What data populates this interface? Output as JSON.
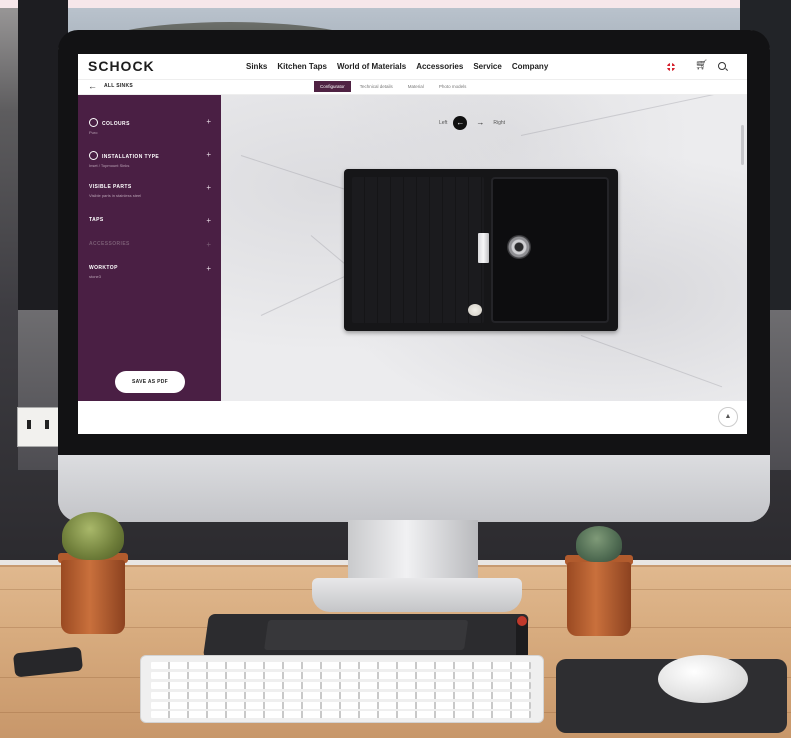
{
  "header": {
    "logo": "SCHOCK",
    "nav": [
      "Sinks",
      "Kitchen Taps",
      "World of Materials",
      "Accessories",
      "Service",
      "Company"
    ],
    "icons": [
      "flag-icon",
      "cart-icon",
      "search-icon"
    ]
  },
  "subnav": {
    "back_label": "ALL SINKS",
    "tabs": [
      {
        "label": "Configurator",
        "active": true
      },
      {
        "label": "Technical details",
        "active": false
      },
      {
        "label": "Material",
        "active": false
      },
      {
        "label": "Photo models",
        "active": false
      }
    ]
  },
  "sidebar": {
    "items": [
      {
        "title": "COLOURS",
        "subtitle": "Puro",
        "icon": "circle-icon",
        "enabled": true
      },
      {
        "title": "INSTALLATION TYPE",
        "subtitle": "Inset / Topmount Sinks",
        "icon": "circle-icon",
        "enabled": true
      },
      {
        "title": "VISIBLE PARTS",
        "subtitle": "Visible parts in stainless steel",
        "icon": "",
        "enabled": true
      },
      {
        "title": "TAPS",
        "subtitle": "",
        "icon": "",
        "enabled": true
      },
      {
        "title": "ACCESSORIES",
        "subtitle": "",
        "icon": "",
        "enabled": false
      },
      {
        "title": "WORKTOP",
        "subtitle": "stone3",
        "icon": "",
        "enabled": true
      }
    ],
    "save_label": "SAVE AS PDF"
  },
  "canvas": {
    "left_label": "Left",
    "right_label": "Right",
    "selected_side": "left"
  },
  "colors": {
    "sidebar_bg": "#4a1f44",
    "active_tab_bg": "#4f2243",
    "sink": "#161618"
  }
}
